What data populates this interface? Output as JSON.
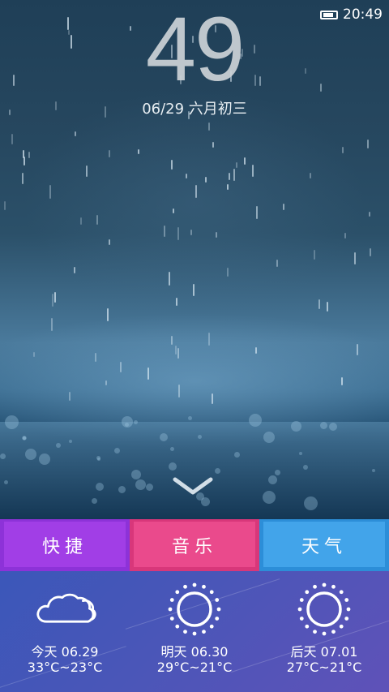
{
  "status_bar": {
    "time": "20:49",
    "battery_icon": "battery-icon"
  },
  "lockscreen": {
    "clock_minutes": "49",
    "date": "06/29 六月初三",
    "unlock_icon": "chevron-down-icon"
  },
  "tabs": [
    {
      "label": "快捷",
      "color": "#a13ee6"
    },
    {
      "label": "音乐",
      "color": "#ea4a8c"
    },
    {
      "label": "天气",
      "color": "#42a4ea"
    }
  ],
  "forecast": [
    {
      "day": "今天 06.29",
      "temp": "33°C~23°C",
      "icon": "cloud-icon"
    },
    {
      "day": "明天 06.30",
      "temp": "29°C~21°C",
      "icon": "sun-icon"
    },
    {
      "day": "后天 07.01",
      "temp": "27°C~21°C",
      "icon": "sun-icon"
    }
  ]
}
